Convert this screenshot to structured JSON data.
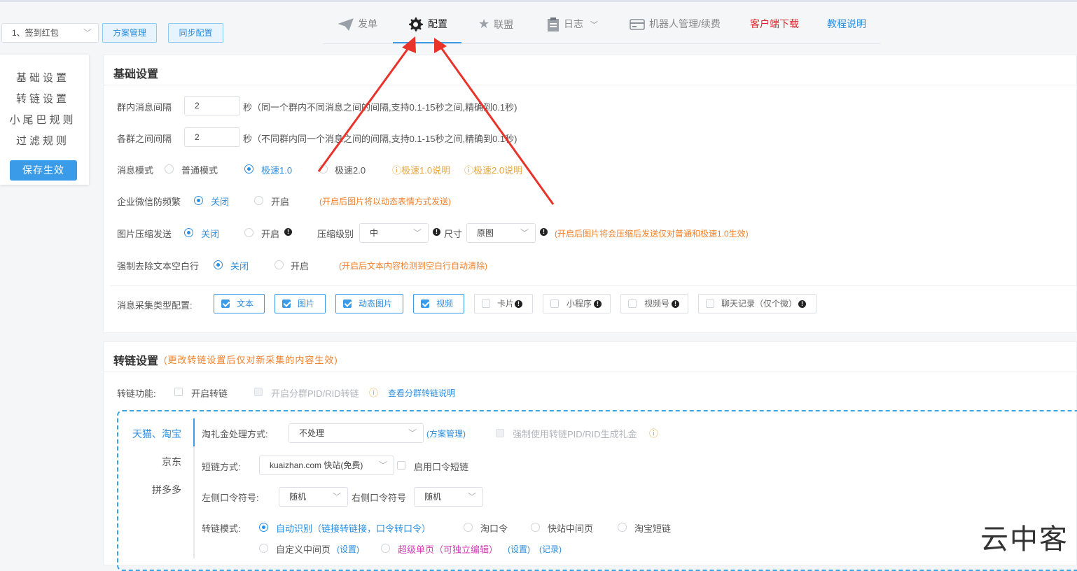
{
  "toolbar": {
    "scheme_select": "1、签到红包",
    "scheme_manage": "方案管理",
    "sync_config": "同步配置"
  },
  "nav": {
    "send": "发单",
    "config": "配置",
    "alliance": "联盟",
    "log": "日志",
    "robot": "机器人管理/续费",
    "client_download": "客户端下载",
    "tutorial": "教程说明"
  },
  "sidebar": {
    "items": [
      "基础设置",
      "转链设置",
      "小尾巴规则",
      "过滤规则"
    ],
    "save": "保存生效"
  },
  "basic": {
    "title": "基础设置",
    "group_interval_label": "群内消息间隔",
    "group_interval_value": "2",
    "group_interval_note": "秒（同一个群内不同消息之间的间隔,支持0.1-15秒之间,精确到0.1秒)",
    "between_interval_label": "各群之间间隔",
    "between_interval_value": "2",
    "between_interval_note": "秒（不同群内同一个消息之间的间隔,支持0.1-15秒之间,精确到0.1秒)",
    "mode_label": "消息模式",
    "mode_normal": "普通模式",
    "mode_fast1": "极速1.0",
    "mode_fast2": "极速2.0",
    "mode_fast1_help": "ⓘ极速1.0说明",
    "mode_fast2_help": "ⓘ极速2.0说明",
    "antifreq_label": "企业微信防频繁",
    "off": "关闭",
    "on": "开启",
    "antifreq_note": "(开启后图片将以动态表情方式发送)",
    "compress_label": "图片压缩发送",
    "compress_level_label": "压缩级别",
    "compress_level_value": "中",
    "size_label": "尺寸",
    "size_value": "原图",
    "compress_note": "(开启后图片将会压缩后发送仅对普通和极速1.0生效)",
    "trim_label": "强制去除文本空白行",
    "trim_note": "(开启后文本内容检测到空白行自动清除)",
    "collect_label": "消息采集类型配置:",
    "collect_types": [
      "文本",
      "图片",
      "动态图片",
      "视频",
      "卡片",
      "小程序",
      "视频号",
      "聊天记录（仅个微）"
    ]
  },
  "convert": {
    "title": "转链设置",
    "title_note": "(更改转链设置后仅对新采集的内容生效)",
    "func_label": "转链功能:",
    "enable": "开启转链",
    "split_pid": "开启分群PID/RID转链",
    "split_help": "查看分群转链说明",
    "tabs": [
      "天猫、淘宝",
      "京东",
      "拼多多"
    ],
    "gift_label": "淘礼金处理方式:",
    "gift_value": "不处理",
    "gift_link": "(方案管理)",
    "force_pid": "强制使用转链PID/RID生成礼金",
    "short_label": "短链方式:",
    "short_value": "kuaizhan.com 快站(免费)",
    "short_cmd": "启用口令短链",
    "left_label": "左侧口令符号:",
    "left_value": "随机",
    "right_label": "右侧口令符号",
    "right_value": "随机",
    "mode_label": "转链模式:",
    "mode_auto": "自动识别（链接转链接，口令转口令）",
    "mode_cmd": "淘口令",
    "mode_kz": "快站中间页",
    "mode_tb": "淘宝短链",
    "mode_custom": "自定义中间页",
    "setting": "(设置)",
    "mode_super": "超级单页（可独立编辑）",
    "record": "(记录)"
  },
  "watermark": "云中客"
}
